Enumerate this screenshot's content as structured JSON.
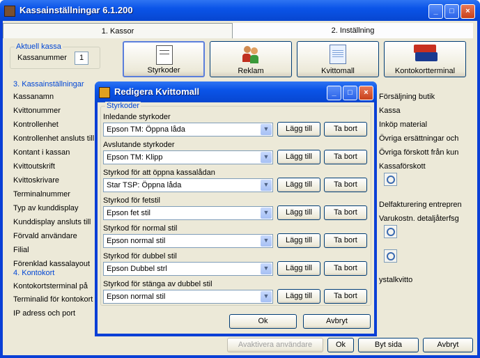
{
  "window": {
    "title": "Kassainställningar 6.1.200"
  },
  "tabs": [
    {
      "label": "1. Kassor"
    },
    {
      "label": "2. Inställning"
    }
  ],
  "aktuell_kassa": {
    "group_title": "Aktuell kassa",
    "label": "Kassanummer",
    "value": "1"
  },
  "big_buttons": [
    {
      "label": "Styrkoder",
      "icon": "document-icon"
    },
    {
      "label": "Reklam",
      "icon": "people-icon"
    },
    {
      "label": "Kvittomall",
      "icon": "notepad-icon"
    },
    {
      "label": "Kontokortterminal",
      "icon": "credit-card-icon"
    }
  ],
  "kassainstallningar": {
    "group_title": "3. Kassainställningar",
    "items": [
      "Kassanamn",
      "Kvittonummer",
      "Kontrollenhet",
      "Kontrollenhet ansluts till",
      "Kontant i kassan",
      "Kvittoutskrift",
      "Kvittoskrivare",
      "Terminalnummer",
      "Typ av kunddisplay",
      "Kunddisplay ansluts till",
      "Förvald användare",
      "Filial",
      "Förenklad kassalayout"
    ]
  },
  "kontokort": {
    "group_title": "4. Kontokort",
    "items": [
      "Kontokortsterminal på",
      "Terminalid för kontokort",
      "IP adress och port"
    ]
  },
  "right_labels": [
    "Försäljning butik",
    "Kassa",
    "Inköp material",
    "Övriga ersättningar och",
    "Övriga förskott från kun",
    "Kassaförskott",
    "Delfakturering entrepren",
    "Varukostn. detaljåterfsg",
    "ystalkvitto"
  ],
  "bottom": {
    "activate": "Avaktivera användare",
    "ok": "Ok",
    "switch": "Byt sida",
    "cancel": "Avbryt"
  },
  "dialog": {
    "title": "Redigera Kvittomall",
    "group_title": "Styrkoder",
    "rows": [
      {
        "label": "Inledande styrkoder",
        "value": "Epson TM: Öppna låda"
      },
      {
        "label": "Avslutande styrkoder",
        "value": "Epson TM: Klipp"
      },
      {
        "label": "Styrkod för att öppna kassalådan",
        "value": "Star TSP: Öppna låda"
      },
      {
        "label": "Styrkod för fetstil",
        "value": "Epson fet stil"
      },
      {
        "label": "Styrkod för normal stil",
        "value": "Epson normal stil"
      },
      {
        "label": "Styrkod för dubbel stil",
        "value": "Epson Dubbel strl"
      },
      {
        "label": "Styrkod för stänga av dubbel stil",
        "value": "Epson normal stil"
      }
    ],
    "add_label": "Lägg till",
    "remove_label": "Ta bort",
    "ok": "Ok",
    "cancel": "Avbryt"
  }
}
